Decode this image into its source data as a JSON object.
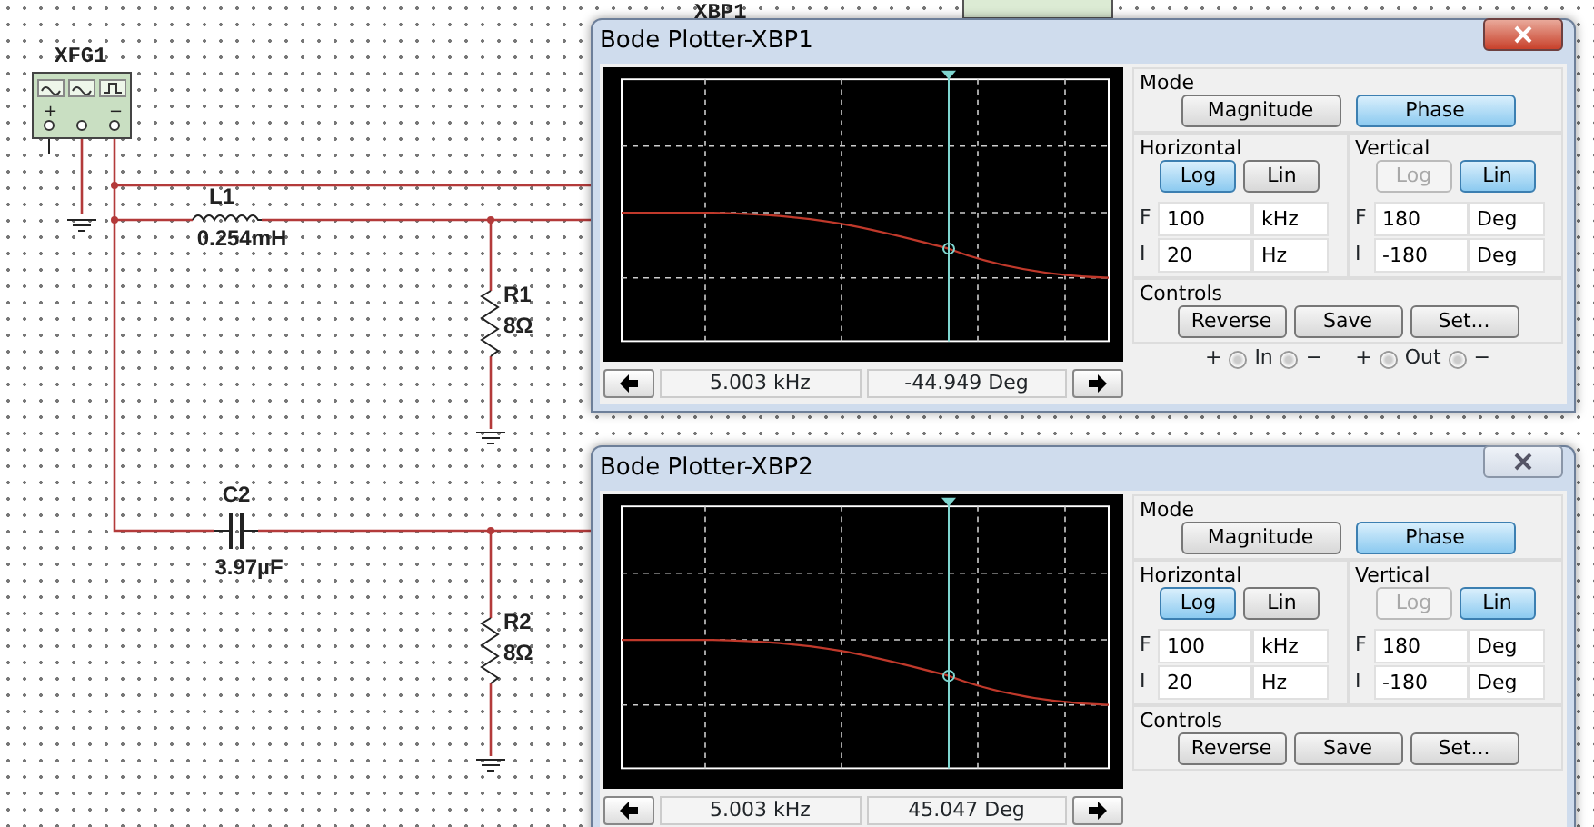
{
  "schematic": {
    "background_label": "XBP1",
    "components": [
      {
        "kind": "generator",
        "name": "XFG1",
        "terminals": [
          "+",
          "−"
        ]
      },
      {
        "kind": "inductor",
        "name": "L1",
        "value": "0.254mH"
      },
      {
        "kind": "resistor",
        "name": "R1",
        "value": "8Ω"
      },
      {
        "kind": "capacitor",
        "name": "C2",
        "value": "3.97µF"
      },
      {
        "kind": "resistor",
        "name": "R2",
        "value": "8Ω"
      }
    ]
  },
  "windows": [
    {
      "title": "Bode Plotter-XBP1",
      "active": true,
      "readout": {
        "frequency": "5.003 kHz",
        "value": "-44.949 Deg"
      },
      "mode": {
        "label": "Mode",
        "buttons": [
          {
            "label": "Magnitude",
            "selected": false
          },
          {
            "label": "Phase",
            "selected": true
          }
        ]
      },
      "horizontal": {
        "label": "Horizontal",
        "buttons": [
          {
            "label": "Log",
            "selected": true,
            "disabled": false
          },
          {
            "label": "Lin",
            "selected": false,
            "disabled": false
          }
        ],
        "fields": [
          {
            "letter": "F",
            "value": "100",
            "unit": "kHz"
          },
          {
            "letter": "I",
            "value": "20",
            "unit": "Hz"
          }
        ]
      },
      "vertical": {
        "label": "Vertical",
        "buttons": [
          {
            "label": "Log",
            "selected": false,
            "disabled": true
          },
          {
            "label": "Lin",
            "selected": true,
            "disabled": false
          }
        ],
        "fields": [
          {
            "letter": "F",
            "value": "180",
            "unit": "Deg"
          },
          {
            "letter": "I",
            "value": "-180",
            "unit": "Deg"
          }
        ]
      },
      "controls": {
        "label": "Controls",
        "buttons": [
          "Reverse",
          "Save",
          "Set..."
        ]
      },
      "terminals": [
        "+",
        "In",
        "−",
        "+",
        "Out",
        "−"
      ]
    },
    {
      "title": "Bode Plotter-XBP2",
      "active": false,
      "readout": {
        "frequency": "5.003 kHz",
        "value": "45.047 Deg"
      },
      "mode": {
        "label": "Mode",
        "buttons": [
          {
            "label": "Magnitude",
            "selected": false
          },
          {
            "label": "Phase",
            "selected": true
          }
        ]
      },
      "horizontal": {
        "label": "Horizontal",
        "buttons": [
          {
            "label": "Log",
            "selected": true,
            "disabled": false
          },
          {
            "label": "Lin",
            "selected": false,
            "disabled": false
          }
        ],
        "fields": [
          {
            "letter": "F",
            "value": "100",
            "unit": "kHz"
          },
          {
            "letter": "I",
            "value": "20",
            "unit": "Hz"
          }
        ]
      },
      "vertical": {
        "label": "Vertical",
        "buttons": [
          {
            "label": "Log",
            "selected": false,
            "disabled": true
          },
          {
            "label": "Lin",
            "selected": true,
            "disabled": false
          }
        ],
        "fields": [
          {
            "letter": "F",
            "value": "180",
            "unit": "Deg"
          },
          {
            "letter": "I",
            "value": "-180",
            "unit": "Deg"
          }
        ]
      },
      "controls": {
        "label": "Controls",
        "buttons": [
          "Reverse",
          "Save",
          "Set..."
        ]
      }
    }
  ]
}
